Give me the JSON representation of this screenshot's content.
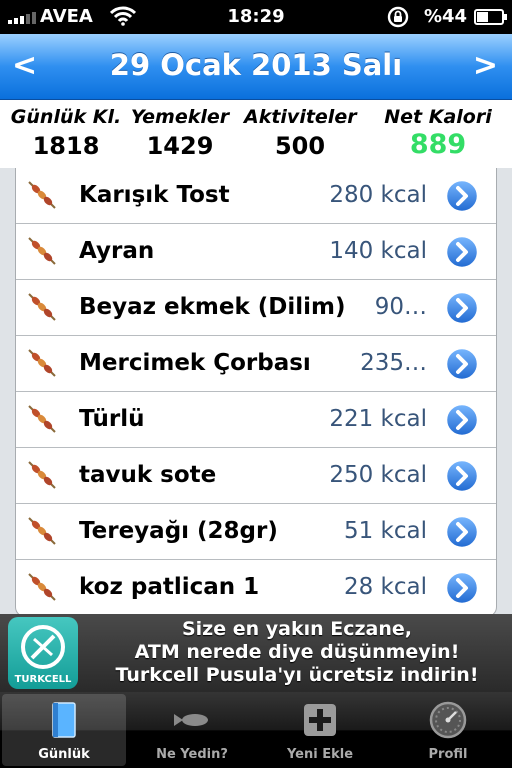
{
  "status_bar": {
    "carrier": "AVEA",
    "time": "18:29",
    "battery": "%44",
    "battery_level": 0.44
  },
  "nav": {
    "prev_label": "<",
    "title": "29 Ocak 2013 Salı",
    "next_label": ">"
  },
  "summary": {
    "daily_label": "Günlük Kl.",
    "daily_value": "1818",
    "meals_label": "Yemekler",
    "meals_value": "1429",
    "activities_label": "Aktiviteler",
    "activities_value": "500",
    "net_label": "Net Kalori",
    "net_value": "889",
    "net_color": "#33dd66"
  },
  "entries": [
    {
      "name": "Karışık Tost",
      "kcal": "280 kcal"
    },
    {
      "name": "Ayran",
      "kcal": "140 kcal"
    },
    {
      "name": "Beyaz ekmek (Dilim)",
      "kcal": "90…"
    },
    {
      "name": "Mercimek Çorbası",
      "kcal": "235…"
    },
    {
      "name": "Türlü",
      "kcal": "221 kcal"
    },
    {
      "name": "tavuk sote",
      "kcal": "250 kcal"
    },
    {
      "name": "Tereyağı (28gr)",
      "kcal": "51 kcal"
    },
    {
      "name": "koz patlican 1",
      "kcal": "28 kcal"
    }
  ],
  "banner": {
    "logo_label": "TURKCELL",
    "line1": "Size en yakın Eczane,",
    "line2": "ATM nerede diye düşünmeyin!",
    "line3": "Turkcell Pusula'yı ücretsiz indirin!"
  },
  "tabs": [
    {
      "label": "Günlük",
      "icon": "book-icon"
    },
    {
      "label": "Ne Yedin?",
      "icon": "fish-icon"
    },
    {
      "label": "Yeni Ekle",
      "icon": "plus-icon"
    },
    {
      "label": "Profil",
      "icon": "speedometer-icon"
    }
  ],
  "colors": {
    "nav_blue": "#1a7ee8",
    "kcal_text": "#38557a",
    "disclosure_blue": "#2b7ae0"
  }
}
